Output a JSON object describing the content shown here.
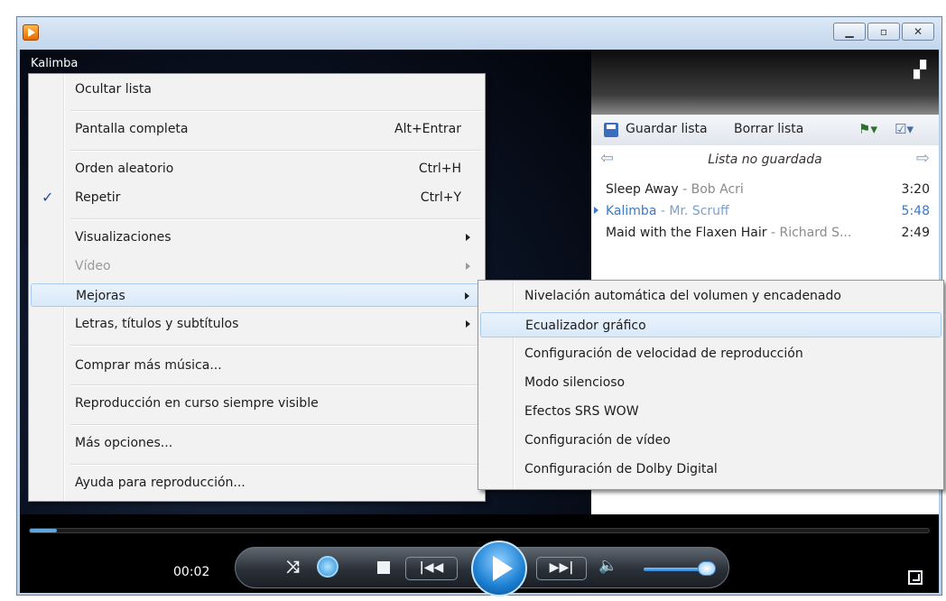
{
  "player": {
    "now_playing": "Kalimba",
    "time": "00:02",
    "seek_progress": 0.03,
    "volume": 0.85
  },
  "playlist": {
    "save_label": "Guardar lista",
    "clear_label": "Borrar lista",
    "name": "Lista no guardada",
    "tracks": [
      {
        "title": "Sleep Away",
        "artist": " - Bob Acri",
        "duration": "3:20",
        "playing": false
      },
      {
        "title": "Kalimba",
        "artist": " - Mr. Scruff",
        "duration": "5:48",
        "playing": true
      },
      {
        "title": "Maid with the Flaxen Hair",
        "artist": " - Richard S...",
        "duration": "2:49",
        "playing": false
      }
    ]
  },
  "menu": {
    "items": [
      {
        "label": "Ocultar lista"
      },
      {
        "label": "Pantalla completa",
        "shortcut": "Alt+Entrar"
      },
      {
        "label": "Orden aleatorio",
        "shortcut": "Ctrl+H"
      },
      {
        "label": "Repetir",
        "shortcut": "Ctrl+Y",
        "checked": true
      },
      {
        "label": "Visualizaciones"
      },
      {
        "label": "Vídeo",
        "disabled": true
      },
      {
        "label": "Mejoras",
        "highlighted": true
      },
      {
        "label": "Letras, títulos y subtítulos"
      },
      {
        "label": "Comprar más música..."
      },
      {
        "label": "Reproducción en curso siempre visible"
      },
      {
        "label": "Más opciones..."
      },
      {
        "label": "Ayuda para reproducción..."
      }
    ],
    "check_glyph": "✓"
  },
  "submenu": {
    "items": [
      {
        "label": "Nivelación automática del volumen y encadenado"
      },
      {
        "label": "Ecualizador gráfico",
        "highlighted": true
      },
      {
        "label": "Configuración de velocidad de reproducción"
      },
      {
        "label": "Modo silencioso"
      },
      {
        "label": "Efectos SRS WOW"
      },
      {
        "label": "Configuración de vídeo"
      },
      {
        "label": "Configuración de Dolby Digital"
      }
    ]
  },
  "colors": {
    "accent": "#3b78c8",
    "highlight": "#d9e9f9"
  },
  "icons": {
    "app": "media-player-icon",
    "minimize": "minimize-icon",
    "maximize": "maximize-icon",
    "close": "close-icon"
  }
}
